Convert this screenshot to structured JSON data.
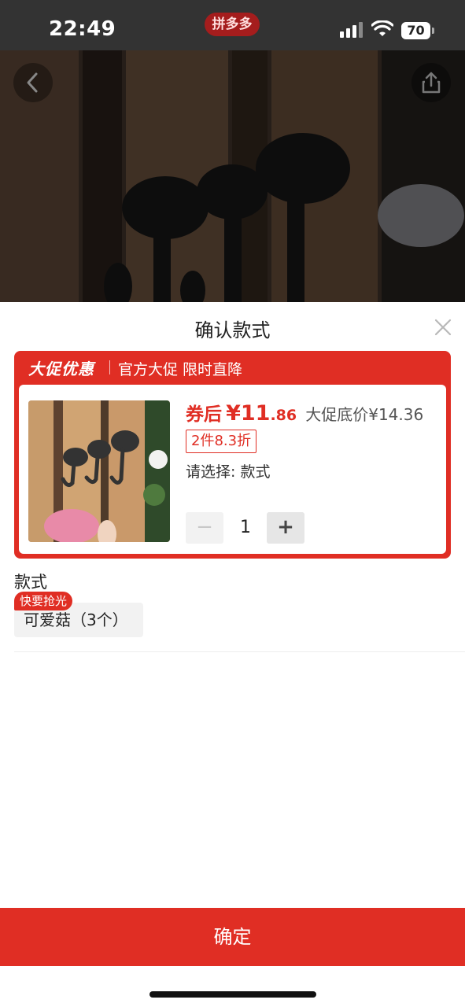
{
  "status_bar": {
    "time": "22:49",
    "app_badge": "拼多多",
    "battery_level": "70"
  },
  "sheet": {
    "title": "确认款式"
  },
  "promo": {
    "brand": "大促优惠",
    "subtitle": "官方大促 限时直降",
    "coupon_label": "券后",
    "price_int": "¥11",
    "price_dec": ".86",
    "original_price": "大促底价¥14.36",
    "discount_badge": "2件8.3折",
    "choose_label": "请选择: 款式",
    "quantity": "1",
    "minus": "−",
    "plus": "+"
  },
  "style_section": {
    "title": "款式",
    "options": [
      {
        "label": "可爱菇（3个）",
        "tag": "快要抢光"
      }
    ]
  },
  "confirm_button": "确定",
  "colors": {
    "accent": "#e02e24",
    "status_bar": "#333333"
  },
  "icons": {
    "back": "chevron-left-icon",
    "share": "share-icon",
    "close": "close-icon"
  }
}
